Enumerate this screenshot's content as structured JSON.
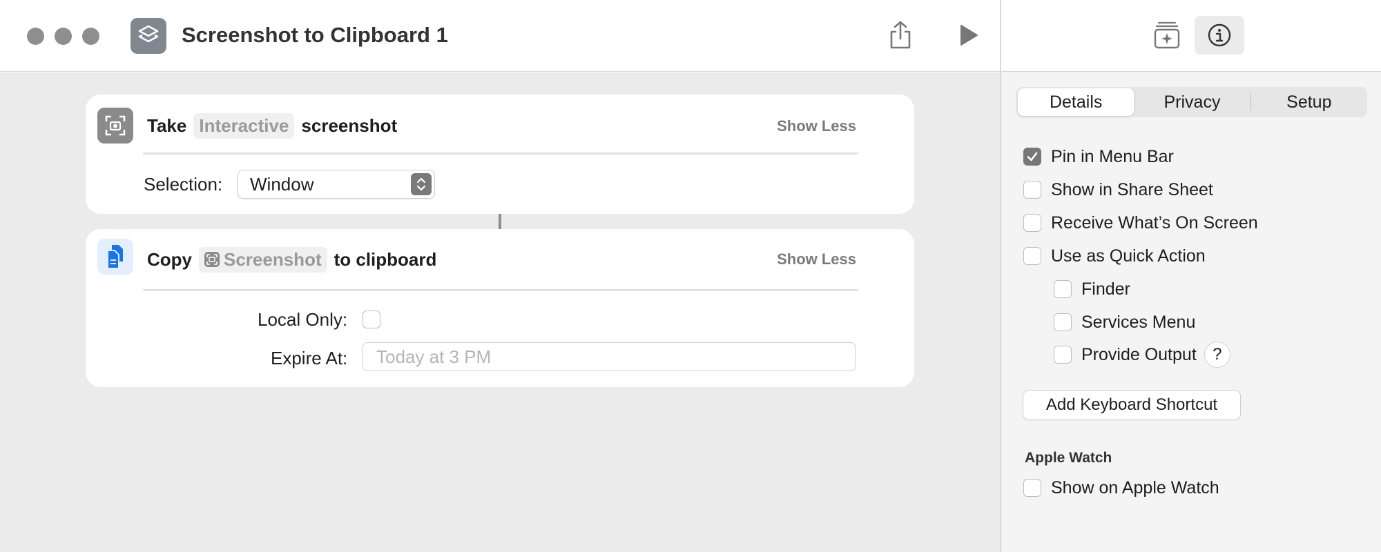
{
  "window": {
    "title": "Screenshot to Clipboard 1",
    "app_icon": "shortcuts-icon",
    "toolbar_icons": [
      "share-icon",
      "play-icon"
    ]
  },
  "actions": [
    {
      "icon": "screenshot-icon",
      "verb": "Take",
      "token": "Interactive",
      "noun": "screenshot",
      "show_less": "Show Less",
      "params": {
        "selection_label": "Selection:",
        "selection_value": "Window"
      }
    },
    {
      "icon": "copy-document-icon",
      "verb": "Copy",
      "token": "Screenshot",
      "token_icon": "screenshot-icon",
      "noun": "to clipboard",
      "show_less": "Show Less",
      "params": {
        "local_only_label": "Local Only:",
        "local_only_checked": false,
        "expire_label": "Expire At:",
        "expire_placeholder": "Today at 3 PM"
      }
    }
  ],
  "inspector": {
    "toolbar_icons": [
      "library-add-icon",
      "info-icon"
    ],
    "tabs": [
      "Details",
      "Privacy",
      "Setup"
    ],
    "active_tab": "Details",
    "options": [
      {
        "label": "Pin in Menu Bar",
        "checked": true
      },
      {
        "label": "Show in Share Sheet",
        "checked": false
      },
      {
        "label": "Receive What’s On Screen",
        "checked": false
      },
      {
        "label": "Use as Quick Action",
        "checked": false
      },
      {
        "label": "Finder",
        "checked": false
      },
      {
        "label": "Services Menu",
        "checked": false
      },
      {
        "label": "Provide Output",
        "checked": false
      }
    ],
    "help_label": "?",
    "keyboard_button": "Add Keyboard Shortcut",
    "apple_watch": {
      "heading": "Apple Watch",
      "option": {
        "label": "Show on Apple Watch",
        "checked": false
      }
    }
  },
  "colors": {
    "accent_blue": "#1a73e8",
    "checkbox_checked": "#777777",
    "editor_bg": "#ebebeb"
  }
}
